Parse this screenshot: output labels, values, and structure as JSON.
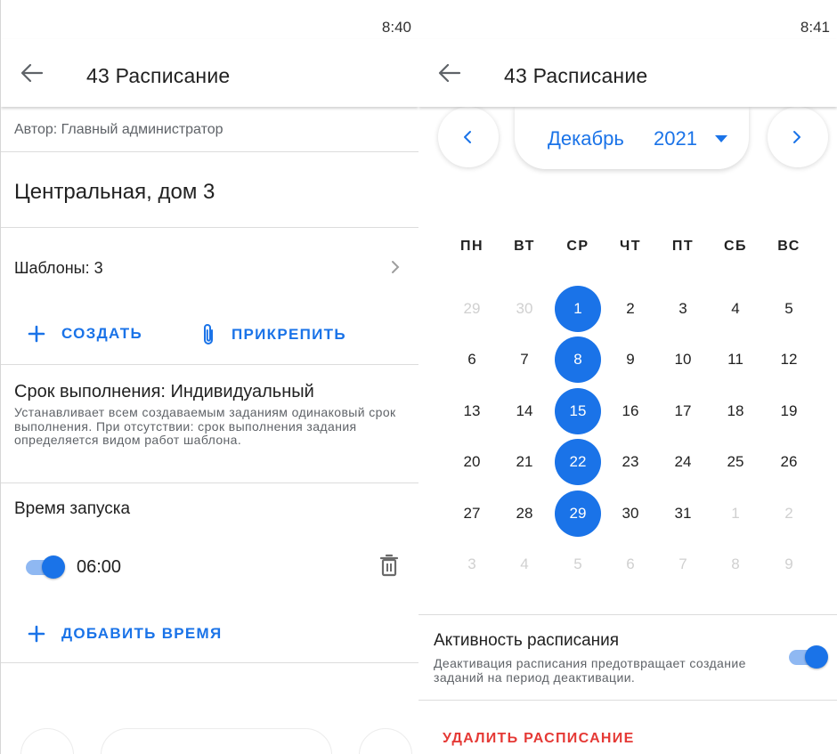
{
  "left": {
    "status_time": "8:40",
    "title": "43 Расписание",
    "author": "Автор: Главный администратор",
    "address": "Центральная, дом 3",
    "templates_label": "Шаблоны: 3",
    "create_label": "СОЗДАТЬ",
    "attach_label": "ПРИКРЕПИТЬ",
    "deadline_title": "Срок выполнения: Индивидуальный",
    "deadline_desc": "Устанавливает всем создаваемым заданиям одинаковый срок выполнения. При отсутствии: срок выполнения задания определяется видом работ шаблона.",
    "launch_title": "Время запуска",
    "launch_time": "06:00",
    "launch_enabled": true,
    "add_time_label": "ДОБАВИТЬ ВРЕМЯ"
  },
  "right": {
    "status_time": "8:41",
    "title": "43 Расписание",
    "month": "Декабрь",
    "year": "2021",
    "weekdays": [
      "ПН",
      "ВТ",
      "СР",
      "ЧТ",
      "ПТ",
      "СБ",
      "ВС"
    ],
    "weeks": [
      [
        "29",
        "30",
        "1",
        "2",
        "3",
        "4",
        "5"
      ],
      [
        "6",
        "7",
        "8",
        "9",
        "10",
        "11",
        "12"
      ],
      [
        "13",
        "14",
        "15",
        "16",
        "17",
        "18",
        "19"
      ],
      [
        "20",
        "21",
        "22",
        "23",
        "24",
        "25",
        "26"
      ],
      [
        "27",
        "28",
        "29",
        "30",
        "31",
        "1",
        "2"
      ],
      [
        "3",
        "4",
        "5",
        "6",
        "7",
        "8",
        "9"
      ]
    ],
    "selected_days": [
      "1",
      "8",
      "15",
      "22",
      "29"
    ],
    "active_title": "Активность расписания",
    "active_desc": "Деактивация расписания предотвращает создание заданий на период деактивации.",
    "active_enabled": true,
    "delete_label": "УДАЛИТЬ РАСПИСАНИЕ"
  },
  "colors": {
    "accent": "#1a73e8",
    "accent_light": "#8fb8f2",
    "danger": "#e53935",
    "muted_day": "#d0d0d0"
  }
}
